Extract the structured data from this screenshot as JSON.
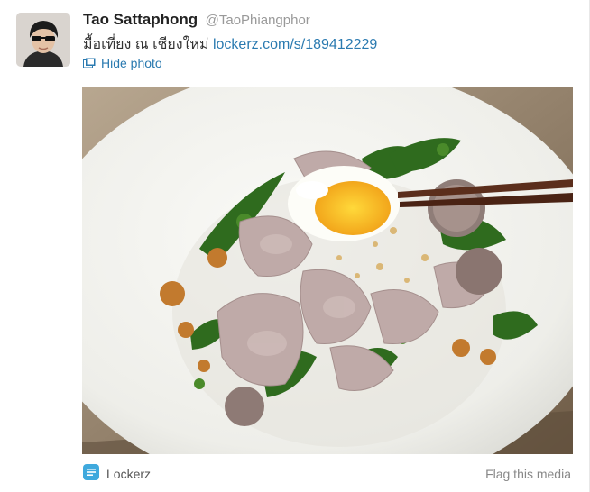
{
  "tweet": {
    "fullname": "Tao Sattaphong",
    "username": "@TaoPhiangphor",
    "text": "มื้อเที่ยง ณ เชียงใหม่",
    "link": "lockerz.com/s/189412229",
    "hide_photo_label": "Hide photo",
    "media_source": "Lockerz",
    "flag_label": "Flag this media"
  },
  "icons": {
    "photo_toggle": "photo-icon",
    "source": "lockerz-icon"
  },
  "colors": {
    "link": "#2a7ab0",
    "muted": "#999999",
    "lockerz": "#3fa9dd"
  }
}
